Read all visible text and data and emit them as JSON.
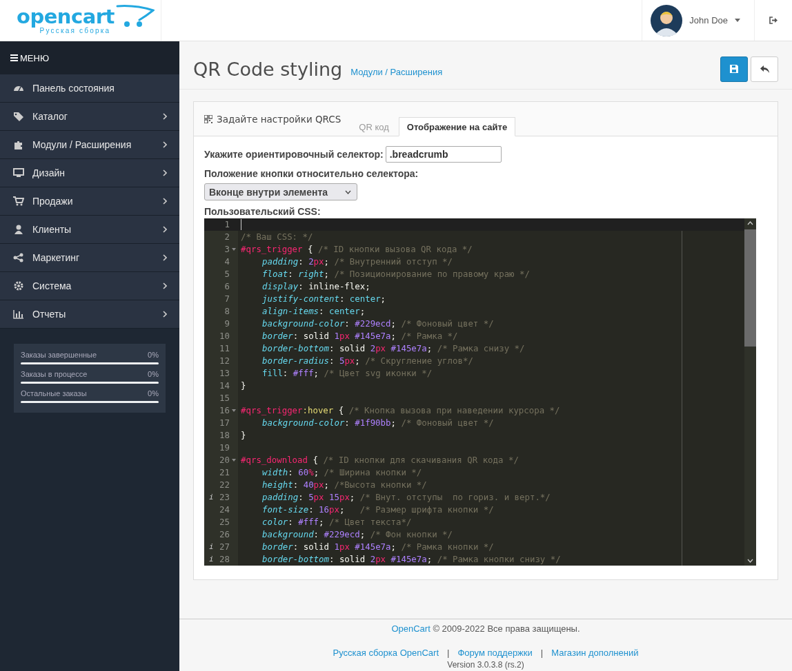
{
  "header": {
    "logo": {
      "name": "opencart",
      "subtitle": "Русская сборка"
    },
    "user": {
      "name": "John Doe"
    }
  },
  "sidebar": {
    "title": "МЕНЮ",
    "items": [
      {
        "label": "Панель состояния",
        "has_children": false
      },
      {
        "label": "Каталог",
        "has_children": true
      },
      {
        "label": "Модули / Расширения",
        "has_children": true
      },
      {
        "label": "Дизайн",
        "has_children": true
      },
      {
        "label": "Продажи",
        "has_children": true
      },
      {
        "label": "Клиенты",
        "has_children": true
      },
      {
        "label": "Маркетинг",
        "has_children": true
      },
      {
        "label": "Система",
        "has_children": true
      },
      {
        "label": "Отчеты",
        "has_children": true
      }
    ],
    "stats": [
      {
        "label": "Заказы завершенные",
        "value": "0%",
        "level": 0
      },
      {
        "label": "Заказы в процессе",
        "value": "0%",
        "level": 0
      },
      {
        "label": "Остальные заказы",
        "value": "0%",
        "level": 0
      }
    ]
  },
  "page": {
    "title": "QR Code styling",
    "breadcrumb": "Модули / Расширения"
  },
  "panel": {
    "title": "Задайте настройки QRCS",
    "tabs": [
      {
        "label": "QR код",
        "selected": false
      },
      {
        "label": "Отображение на сайте",
        "selected": true
      }
    ],
    "selector_label": "Укажите ориентировочный селектор:",
    "selector_value": ".breadcrumb",
    "position_label": "Положение кнопки относительно селектора:",
    "position_value": "Вконце внутри элемента",
    "css_label": "Пользовательский CSS:",
    "editor": {
      "lines": [
        {
          "n": "1",
          "active": true
        },
        {
          "n": "2",
          "indent": false,
          "tokens": [
            {
              "text": "/* Ваш CSS: */",
              "kind": "com"
            }
          ]
        },
        {
          "n": "3",
          "fold": true,
          "indent": false,
          "tokens": [
            {
              "text": "#qrs_trigger",
              "kind": "sel"
            },
            {
              "text": " { ",
              "kind": "p"
            },
            {
              "text": "/* ID кнопки вызова QR кода */",
              "kind": "com"
            }
          ]
        },
        {
          "n": "4",
          "indent": true,
          "tokens": [
            {
              "text": "padding",
              "kind": "prop"
            },
            {
              "text": ": ",
              "kind": "p"
            },
            {
              "text": "2",
              "kind": "num"
            },
            {
              "text": "px",
              "kind": "unit"
            },
            {
              "text": "; ",
              "kind": "p"
            },
            {
              "text": "/* Внутренний отступ */",
              "kind": "com"
            }
          ]
        },
        {
          "n": "5",
          "indent": true,
          "tokens": [
            {
              "text": "float",
              "kind": "prop"
            },
            {
              "text": ": ",
              "kind": "p"
            },
            {
              "text": "right",
              "kind": "kwi"
            },
            {
              "text": "; ",
              "kind": "p"
            },
            {
              "text": "/* Позиционирование по правому краю */",
              "kind": "com"
            }
          ]
        },
        {
          "n": "6",
          "indent": true,
          "tokens": [
            {
              "text": "display",
              "kind": "prop"
            },
            {
              "text": ": inline-flex;",
              "kind": "p"
            }
          ]
        },
        {
          "n": "7",
          "indent": true,
          "tokens": [
            {
              "text": "justify-content",
              "kind": "prop"
            },
            {
              "text": ": ",
              "kind": "p"
            },
            {
              "text": "center",
              "kind": "kw"
            },
            {
              "text": ";",
              "kind": "p"
            }
          ]
        },
        {
          "n": "8",
          "indent": true,
          "tokens": [
            {
              "text": "align-items",
              "kind": "prop"
            },
            {
              "text": ": ",
              "kind": "p"
            },
            {
              "text": "center",
              "kind": "kw"
            },
            {
              "text": ";",
              "kind": "p"
            }
          ]
        },
        {
          "n": "9",
          "indent": true,
          "tokens": [
            {
              "text": "background-color",
              "kind": "prop"
            },
            {
              "text": ": ",
              "kind": "p"
            },
            {
              "text": "#229ecd",
              "kind": "hex"
            },
            {
              "text": "; ",
              "kind": "p"
            },
            {
              "text": "/* Фоновый цвет */",
              "kind": "com"
            }
          ]
        },
        {
          "n": "10",
          "indent": true,
          "tokens": [
            {
              "text": "border",
              "kind": "prop"
            },
            {
              "text": ": solid ",
              "kind": "p"
            },
            {
              "text": "1",
              "kind": "num"
            },
            {
              "text": "px",
              "kind": "unit"
            },
            {
              "text": " #145e7a",
              "kind": "hex"
            },
            {
              "text": "; ",
              "kind": "p"
            },
            {
              "text": "/* Рамка */",
              "kind": "com"
            }
          ]
        },
        {
          "n": "11",
          "indent": true,
          "tokens": [
            {
              "text": "border-bottom",
              "kind": "prop"
            },
            {
              "text": ": solid ",
              "kind": "p"
            },
            {
              "text": "2",
              "kind": "num"
            },
            {
              "text": "px",
              "kind": "unit"
            },
            {
              "text": " #145e7a",
              "kind": "hex"
            },
            {
              "text": "; ",
              "kind": "p"
            },
            {
              "text": "/* Рамка снизу */",
              "kind": "com"
            }
          ]
        },
        {
          "n": "12",
          "indent": true,
          "tokens": [
            {
              "text": "border-radius",
              "kind": "prop"
            },
            {
              "text": ": ",
              "kind": "p"
            },
            {
              "text": "5",
              "kind": "num"
            },
            {
              "text": "px",
              "kind": "unit"
            },
            {
              "text": "; ",
              "kind": "p"
            },
            {
              "text": "/* Скругление углов*/",
              "kind": "com"
            }
          ]
        },
        {
          "n": "13",
          "indent": true,
          "tokens": [
            {
              "text": "fill",
              "kind": "kw"
            },
            {
              "text": ": ",
              "kind": "p"
            },
            {
              "text": "#fff",
              "kind": "hex"
            },
            {
              "text": "; ",
              "kind": "p"
            },
            {
              "text": "/* Цвет svg иконки */",
              "kind": "com"
            }
          ]
        },
        {
          "n": "14",
          "indent": false,
          "tokens": [
            {
              "text": "}",
              "kind": "p"
            }
          ]
        },
        {
          "n": "15"
        },
        {
          "n": "16",
          "fold": true,
          "indent": false,
          "tokens": [
            {
              "text": "#qrs_trigger",
              "kind": "sel"
            },
            {
              "text": ":hover",
              "kind": "pseudo"
            },
            {
              "text": " { ",
              "kind": "p"
            },
            {
              "text": "/* Кнопка вызова при наведении курсора */",
              "kind": "com"
            }
          ]
        },
        {
          "n": "17",
          "indent": true,
          "tokens": [
            {
              "text": "background-color",
              "kind": "prop"
            },
            {
              "text": ": ",
              "kind": "p"
            },
            {
              "text": "#1f90bb",
              "kind": "hex"
            },
            {
              "text": "; ",
              "kind": "p"
            },
            {
              "text": "/* Фоновый цвет */",
              "kind": "com"
            }
          ]
        },
        {
          "n": "18",
          "indent": false,
          "tokens": [
            {
              "text": "}",
              "kind": "p"
            }
          ]
        },
        {
          "n": "19"
        },
        {
          "n": "20",
          "fold": true,
          "indent": false,
          "tokens": [
            {
              "text": "#qrs_download",
              "kind": "sel"
            },
            {
              "text": " { ",
              "kind": "p"
            },
            {
              "text": "/* ID кнопки для скачивания QR кода */",
              "kind": "com"
            }
          ]
        },
        {
          "n": "21",
          "indent": true,
          "tokens": [
            {
              "text": "width",
              "kind": "prop"
            },
            {
              "text": ": ",
              "kind": "p"
            },
            {
              "text": "60",
              "kind": "num"
            },
            {
              "text": "%",
              "kind": "unit"
            },
            {
              "text": "; ",
              "kind": "p"
            },
            {
              "text": "/* Ширина кнопки */",
              "kind": "com"
            }
          ]
        },
        {
          "n": "22",
          "indent": true,
          "tokens": [
            {
              "text": "height",
              "kind": "prop"
            },
            {
              "text": ": ",
              "kind": "p"
            },
            {
              "text": "40",
              "kind": "num"
            },
            {
              "text": "px",
              "kind": "unit"
            },
            {
              "text": "; ",
              "kind": "p"
            },
            {
              "text": "/*Высота кнопки */",
              "kind": "com"
            }
          ]
        },
        {
          "n": "23",
          "marker": "i",
          "indent": true,
          "tokens": [
            {
              "text": "padding",
              "kind": "prop"
            },
            {
              "text": ": ",
              "kind": "p"
            },
            {
              "text": "5",
              "kind": "num"
            },
            {
              "text": "px",
              "kind": "unit"
            },
            {
              "text": " 15",
              "kind": "num"
            },
            {
              "text": "px",
              "kind": "unit"
            },
            {
              "text": "; ",
              "kind": "p"
            },
            {
              "text": "/* Внут. отступы  по гориз. и верт.*/",
              "kind": "com"
            }
          ]
        },
        {
          "n": "24",
          "indent": true,
          "tokens": [
            {
              "text": "font-size",
              "kind": "prop"
            },
            {
              "text": ": ",
              "kind": "p"
            },
            {
              "text": "16",
              "kind": "num"
            },
            {
              "text": "px",
              "kind": "unit"
            },
            {
              "text": ";   ",
              "kind": "p"
            },
            {
              "text": "/* Размер шрифта кнопки */",
              "kind": "com"
            }
          ]
        },
        {
          "n": "25",
          "indent": true,
          "tokens": [
            {
              "text": "color",
              "kind": "prop"
            },
            {
              "text": ": ",
              "kind": "p"
            },
            {
              "text": "#fff",
              "kind": "hex"
            },
            {
              "text": "; ",
              "kind": "p"
            },
            {
              "text": "/* Цвет текста*/",
              "kind": "com"
            }
          ]
        },
        {
          "n": "26",
          "indent": true,
          "tokens": [
            {
              "text": "background",
              "kind": "prop"
            },
            {
              "text": ": ",
              "kind": "p"
            },
            {
              "text": "#229ecd",
              "kind": "hex"
            },
            {
              "text": "; ",
              "kind": "p"
            },
            {
              "text": "/* Фон кнопки */",
              "kind": "com"
            }
          ]
        },
        {
          "n": "27",
          "marker": "i",
          "indent": true,
          "tokens": [
            {
              "text": "border",
              "kind": "prop"
            },
            {
              "text": ": solid ",
              "kind": "p"
            },
            {
              "text": "1",
              "kind": "num"
            },
            {
              "text": "px",
              "kind": "unit"
            },
            {
              "text": " #145e7a",
              "kind": "hex"
            },
            {
              "text": "; ",
              "kind": "p"
            },
            {
              "text": "/* Рамка кнопки */",
              "kind": "com"
            }
          ]
        },
        {
          "n": "28",
          "marker": "i",
          "indent": true,
          "tokens": [
            {
              "text": "border-bottom",
              "kind": "prop"
            },
            {
              "text": ": solid ",
              "kind": "p"
            },
            {
              "text": "2",
              "kind": "num"
            },
            {
              "text": "px",
              "kind": "unit"
            },
            {
              "text": " #145e7a",
              "kind": "hex"
            },
            {
              "text": "; ",
              "kind": "p"
            },
            {
              "text": "/* Рамка кнопки снизу */",
              "kind": "com"
            }
          ]
        }
      ]
    }
  },
  "footer": {
    "copyright_link": "OpenCart",
    "copyright": "© 2009-2022 Все права защищены.",
    "links": [
      "Русская сборка OpenCart",
      "Форум поддержки",
      "Магазин дополнений"
    ],
    "separator": "|",
    "version": "Version 3.0.3.8 (rs.2)"
  }
}
